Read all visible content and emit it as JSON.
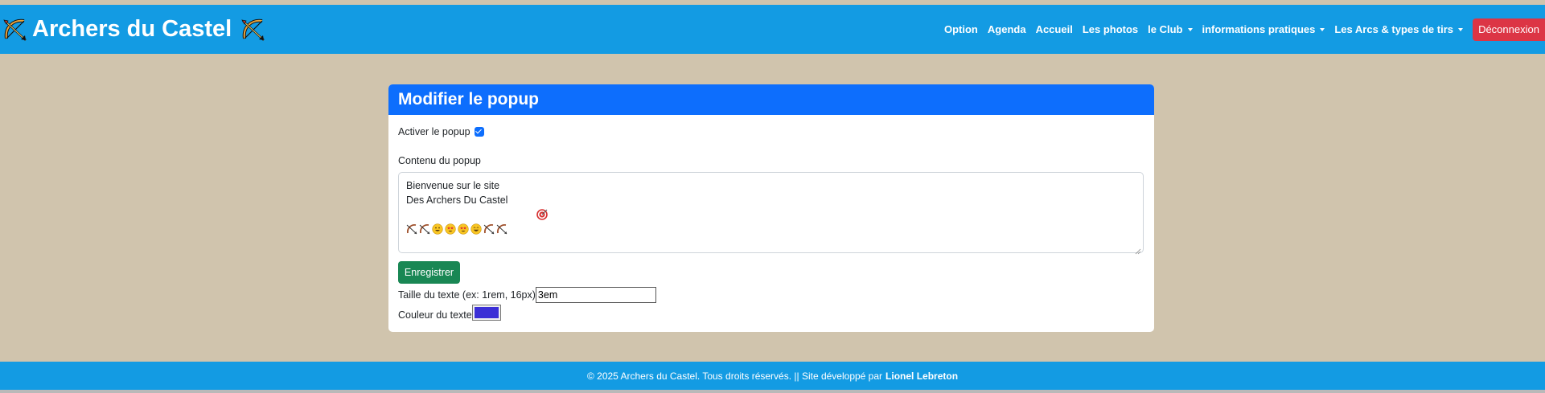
{
  "brand": {
    "title": "Archers du Castel",
    "icon": "bow-and-arrow-icon"
  },
  "nav": {
    "items": [
      {
        "label": "Option",
        "dropdown": false
      },
      {
        "label": "Agenda",
        "dropdown": false
      },
      {
        "label": "Accueil",
        "dropdown": false
      },
      {
        "label": "Les photos",
        "dropdown": false
      },
      {
        "label": "le Club",
        "dropdown": true
      },
      {
        "label": "informations pratiques",
        "dropdown": true
      },
      {
        "label": "Les Arcs & types de tirs",
        "dropdown": true
      }
    ],
    "logout_label": "Déconnexion"
  },
  "card": {
    "title": "Modifier le popup",
    "enable_label": "Activer le popup",
    "enable_checked": true,
    "content_label": "Contenu du popup",
    "content_lines": [
      "Bienvenue sur le site",
      "Des Archers Du Castel"
    ],
    "content_line2_icon": "target-icon",
    "content_emojis": [
      "bow-and-arrow-icon",
      "bow-and-arrow-icon",
      "grinning-face-icon",
      "star-struck-face-icon",
      "star-struck-face-icon",
      "laughing-face-icon",
      "bow-and-arrow-icon",
      "bow-and-arrow-icon"
    ],
    "save_label": "Enregistrer",
    "size_label": "Taille du texte (ex: 1rem, 16px)",
    "size_value": "3em",
    "color_label": "Couleur du texte",
    "color_value": "#3b2fd6"
  },
  "footer": {
    "text": "© 2025 Archers du Castel. Tous droits réservés. || Site développé par",
    "author": "Lionel Lebreton"
  },
  "colors": {
    "navbar": "#139be3",
    "page_bg": "#d0c4ad",
    "card_header": "#0d6efd",
    "save_button": "#198754",
    "logout_button": "#dc3545"
  }
}
